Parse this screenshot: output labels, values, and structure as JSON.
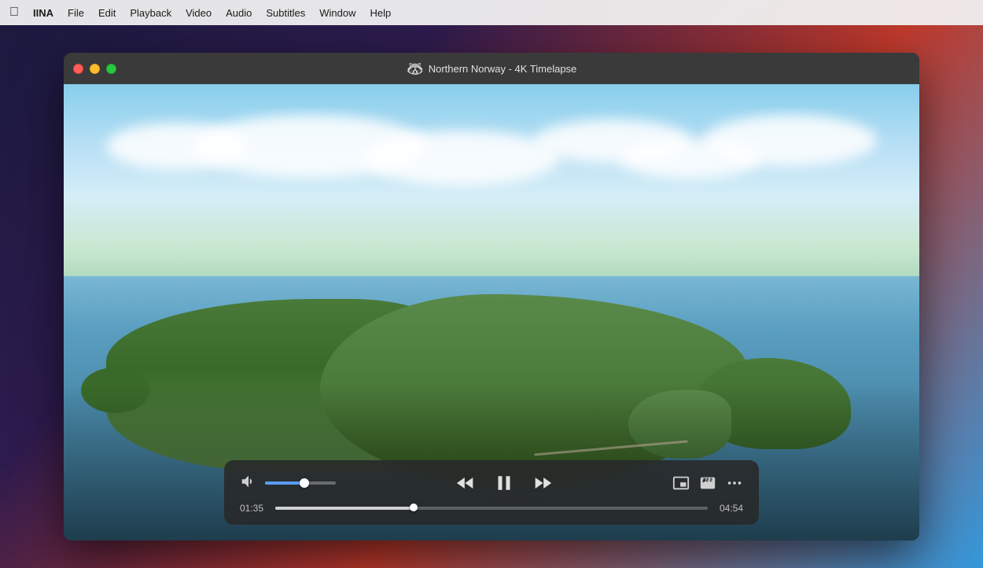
{
  "menubar": {
    "apple": "",
    "items": [
      {
        "id": "iina",
        "label": "IINA"
      },
      {
        "id": "file",
        "label": "File"
      },
      {
        "id": "edit",
        "label": "Edit"
      },
      {
        "id": "playback",
        "label": "Playback"
      },
      {
        "id": "video",
        "label": "Video"
      },
      {
        "id": "audio",
        "label": "Audio"
      },
      {
        "id": "subtitles",
        "label": "Subtitles"
      },
      {
        "id": "window",
        "label": "Window"
      },
      {
        "id": "help",
        "label": "Help"
      }
    ]
  },
  "window": {
    "title": "Northern Norway - 4K Timelapse",
    "icon": "🦝"
  },
  "player": {
    "current_time": "01:35",
    "total_time": "04:54",
    "progress_percent": 32,
    "volume_percent": 55,
    "state": "playing"
  },
  "controls": {
    "rewind_label": "Rewind",
    "pause_label": "Pause",
    "fast_forward_label": "Fast Forward",
    "pip_label": "Picture in Picture",
    "subtitles_label": "Subtitles",
    "more_label": "More Options"
  }
}
